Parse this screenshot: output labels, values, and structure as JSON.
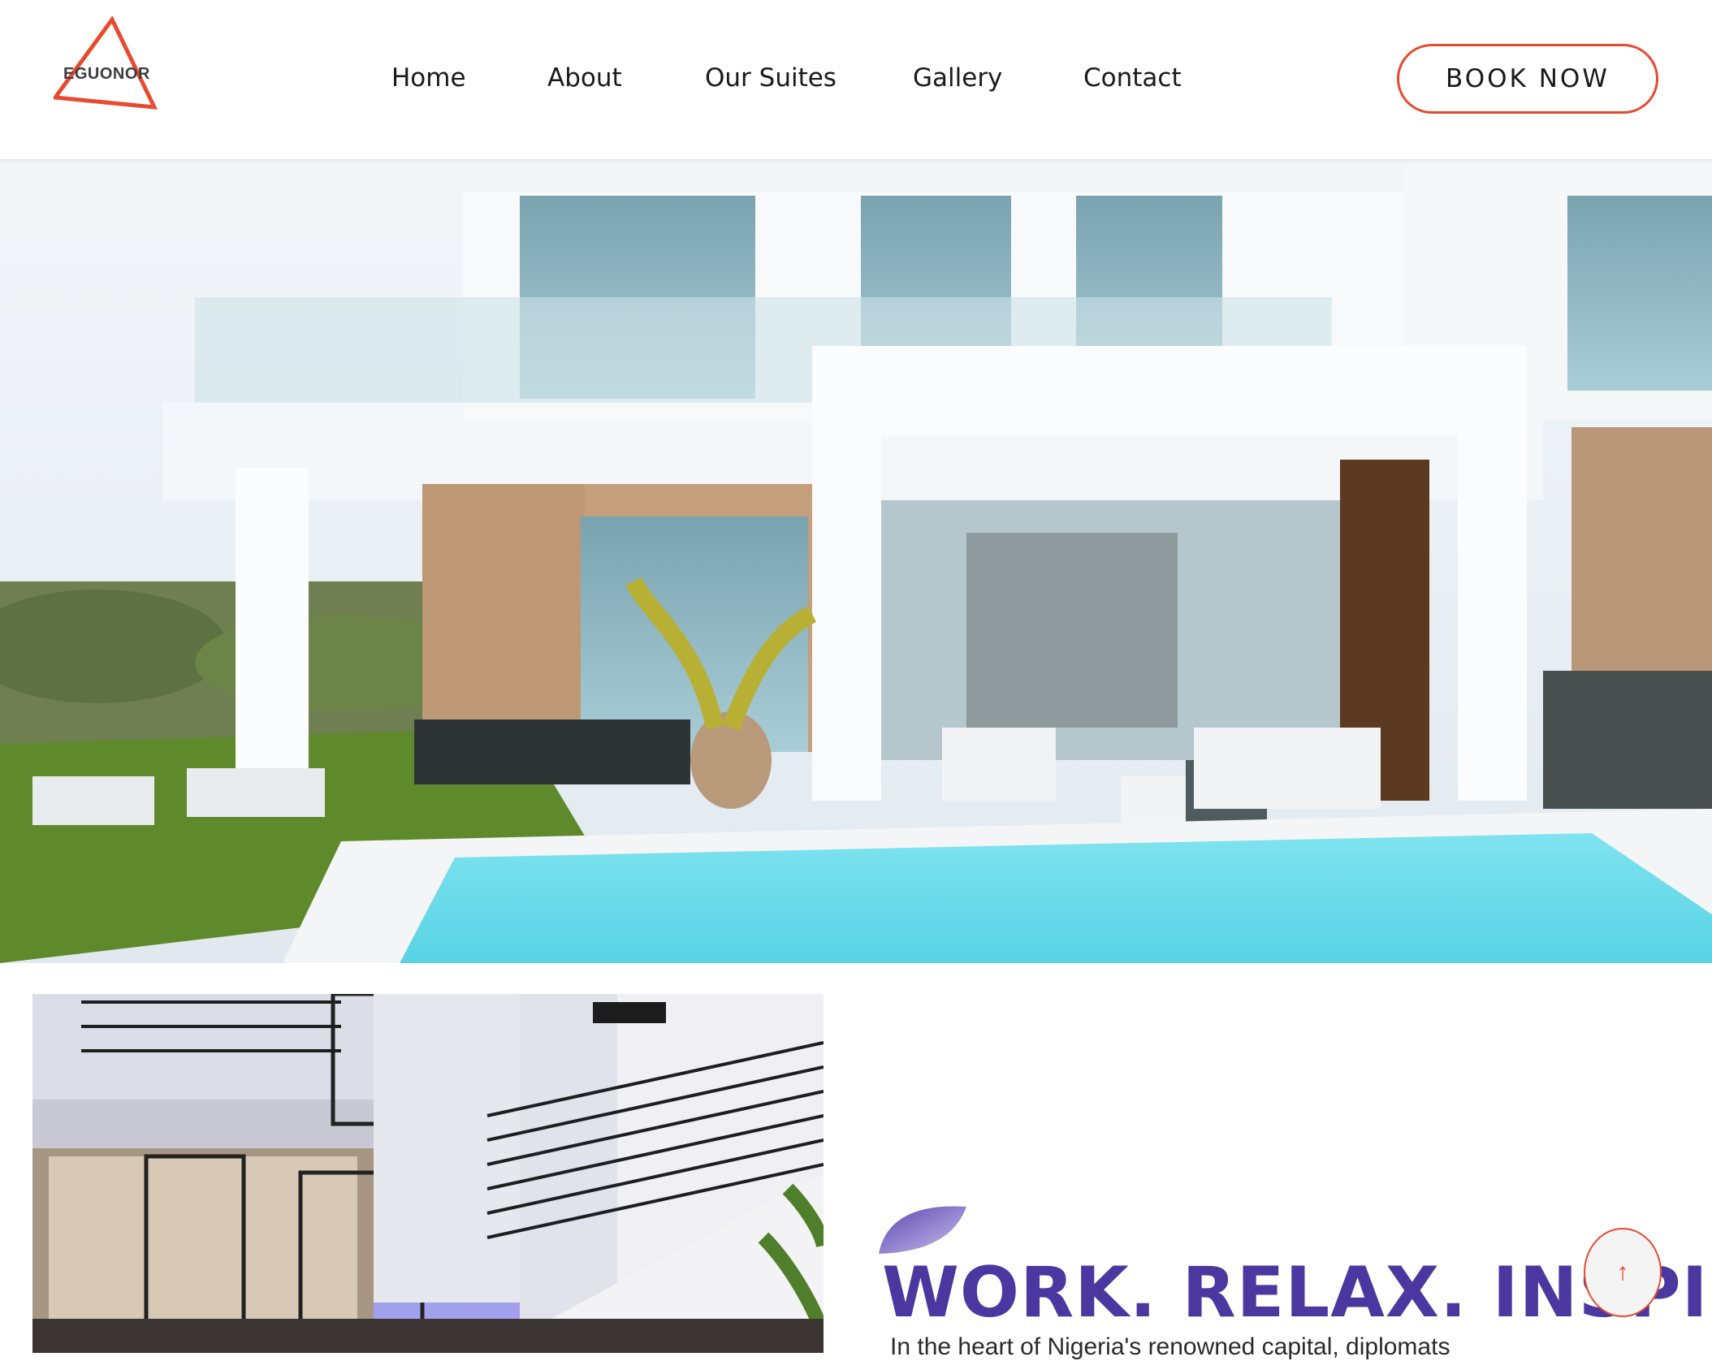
{
  "brand": {
    "name": "EGUONOR",
    "accent": "#e84a2f"
  },
  "nav": {
    "items": [
      {
        "label": "Home"
      },
      {
        "label": "About"
      },
      {
        "label": "Our Suites"
      },
      {
        "label": "Gallery"
      },
      {
        "label": "Contact"
      }
    ]
  },
  "header": {
    "book_label": "BOOK NOW"
  },
  "hero": {
    "image": "modern-white-villa-with-pool-photo"
  },
  "feature": {
    "image": "modern-house-courtyard-staircase-photo",
    "tagline": "WORK. RELAX. INSPIR",
    "intro": "In the heart of Nigeria's renowned capital, diplomats",
    "tagline_color": "#4a37a0"
  },
  "scroll_top": {
    "icon": "arrow-up-icon"
  }
}
